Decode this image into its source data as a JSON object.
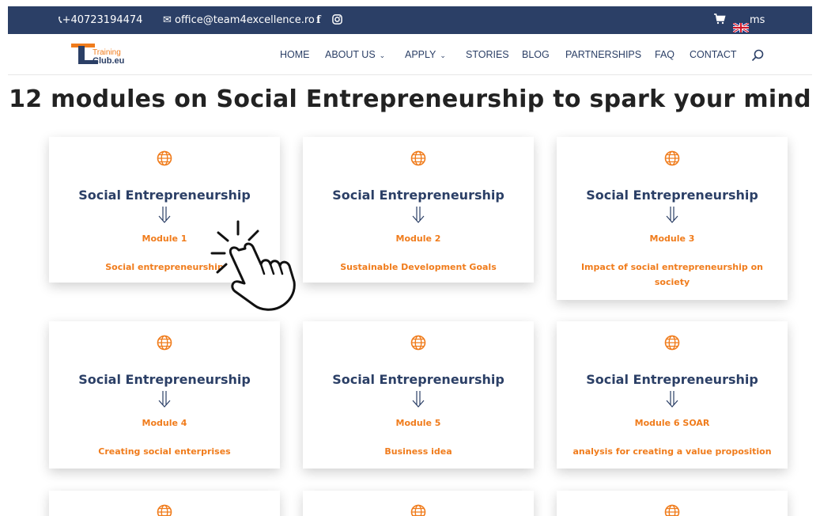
{
  "topbar": {
    "phone": "+40723194474",
    "email": "office@team4excellence.ro",
    "facebook": "f",
    "language_suffix": "ms",
    "icons": [
      "phone-icon",
      "mail-icon",
      "facebook-icon",
      "instagram-icon",
      "cart-icon",
      "uk-flag-icon"
    ]
  },
  "logo": {
    "line1": "Training",
    "line2": "Club.eu"
  },
  "nav": {
    "home": "HOME",
    "about": "ABOUT US",
    "apply": "APPLY",
    "stories": "STORIES",
    "blog": "BLOG",
    "partnerships": "PARTNERSHIPS",
    "faq": "FAQ",
    "contact": "CONTACT",
    "dropdown_chevron": "⌄"
  },
  "main": {
    "heading": "12 modules on Social Entrepreneurship to spark your mind",
    "cards": [
      {
        "title": "Social Entrepreneurship",
        "module": "Module 1",
        "description": "Social entrepreneurship"
      },
      {
        "title": "Social Entrepreneurship",
        "module": "Module 2",
        "description": "Sustainable Development Goals"
      },
      {
        "title": "Social Entrepreneurship",
        "module": "Module 3",
        "description": "Impact of social entrepreneurship on society"
      },
      {
        "title": "Social Entrepreneurship",
        "module": "Module 4",
        "description": "Creating social enterprises"
      },
      {
        "title": "Social Entrepreneurship",
        "module": "Module 5",
        "description": "Business idea"
      },
      {
        "title": "Social Entrepreneurship",
        "module": "Module 6 SOAR",
        "description": "analysis for creating a value proposition"
      }
    ]
  },
  "colors": {
    "navy": "#2b3f66",
    "orange": "#f07c1c",
    "heading": "#222222"
  }
}
